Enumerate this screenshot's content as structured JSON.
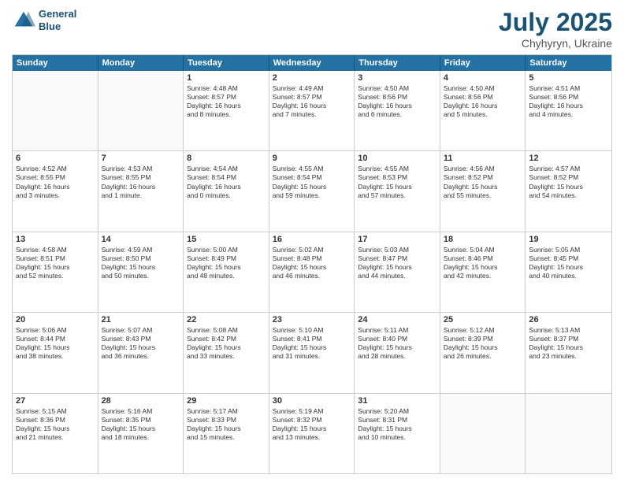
{
  "header": {
    "logo_line1": "General",
    "logo_line2": "Blue",
    "month": "July 2025",
    "location": "Chyhyryn, Ukraine"
  },
  "weekdays": [
    "Sunday",
    "Monday",
    "Tuesday",
    "Wednesday",
    "Thursday",
    "Friday",
    "Saturday"
  ],
  "rows": [
    [
      {
        "day": "",
        "text": "",
        "empty": true
      },
      {
        "day": "",
        "text": "",
        "empty": true
      },
      {
        "day": "1",
        "text": "Sunrise: 4:48 AM\nSunset: 8:57 PM\nDaylight: 16 hours\nand 8 minutes."
      },
      {
        "day": "2",
        "text": "Sunrise: 4:49 AM\nSunset: 8:57 PM\nDaylight: 16 hours\nand 7 minutes."
      },
      {
        "day": "3",
        "text": "Sunrise: 4:50 AM\nSunset: 8:56 PM\nDaylight: 16 hours\nand 6 minutes."
      },
      {
        "day": "4",
        "text": "Sunrise: 4:50 AM\nSunset: 8:56 PM\nDaylight: 16 hours\nand 5 minutes."
      },
      {
        "day": "5",
        "text": "Sunrise: 4:51 AM\nSunset: 8:56 PM\nDaylight: 16 hours\nand 4 minutes."
      }
    ],
    [
      {
        "day": "6",
        "text": "Sunrise: 4:52 AM\nSunset: 8:55 PM\nDaylight: 16 hours\nand 3 minutes."
      },
      {
        "day": "7",
        "text": "Sunrise: 4:53 AM\nSunset: 8:55 PM\nDaylight: 16 hours\nand 1 minute."
      },
      {
        "day": "8",
        "text": "Sunrise: 4:54 AM\nSunset: 8:54 PM\nDaylight: 16 hours\nand 0 minutes."
      },
      {
        "day": "9",
        "text": "Sunrise: 4:55 AM\nSunset: 8:54 PM\nDaylight: 15 hours\nand 59 minutes."
      },
      {
        "day": "10",
        "text": "Sunrise: 4:55 AM\nSunset: 8:53 PM\nDaylight: 15 hours\nand 57 minutes."
      },
      {
        "day": "11",
        "text": "Sunrise: 4:56 AM\nSunset: 8:52 PM\nDaylight: 15 hours\nand 55 minutes."
      },
      {
        "day": "12",
        "text": "Sunrise: 4:57 AM\nSunset: 8:52 PM\nDaylight: 15 hours\nand 54 minutes."
      }
    ],
    [
      {
        "day": "13",
        "text": "Sunrise: 4:58 AM\nSunset: 8:51 PM\nDaylight: 15 hours\nand 52 minutes."
      },
      {
        "day": "14",
        "text": "Sunrise: 4:59 AM\nSunset: 8:50 PM\nDaylight: 15 hours\nand 50 minutes."
      },
      {
        "day": "15",
        "text": "Sunrise: 5:00 AM\nSunset: 8:49 PM\nDaylight: 15 hours\nand 48 minutes."
      },
      {
        "day": "16",
        "text": "Sunrise: 5:02 AM\nSunset: 8:48 PM\nDaylight: 15 hours\nand 46 minutes."
      },
      {
        "day": "17",
        "text": "Sunrise: 5:03 AM\nSunset: 8:47 PM\nDaylight: 15 hours\nand 44 minutes."
      },
      {
        "day": "18",
        "text": "Sunrise: 5:04 AM\nSunset: 8:46 PM\nDaylight: 15 hours\nand 42 minutes."
      },
      {
        "day": "19",
        "text": "Sunrise: 5:05 AM\nSunset: 8:45 PM\nDaylight: 15 hours\nand 40 minutes."
      }
    ],
    [
      {
        "day": "20",
        "text": "Sunrise: 5:06 AM\nSunset: 8:44 PM\nDaylight: 15 hours\nand 38 minutes."
      },
      {
        "day": "21",
        "text": "Sunrise: 5:07 AM\nSunset: 8:43 PM\nDaylight: 15 hours\nand 36 minutes."
      },
      {
        "day": "22",
        "text": "Sunrise: 5:08 AM\nSunset: 8:42 PM\nDaylight: 15 hours\nand 33 minutes."
      },
      {
        "day": "23",
        "text": "Sunrise: 5:10 AM\nSunset: 8:41 PM\nDaylight: 15 hours\nand 31 minutes."
      },
      {
        "day": "24",
        "text": "Sunrise: 5:11 AM\nSunset: 8:40 PM\nDaylight: 15 hours\nand 28 minutes."
      },
      {
        "day": "25",
        "text": "Sunrise: 5:12 AM\nSunset: 8:39 PM\nDaylight: 15 hours\nand 26 minutes."
      },
      {
        "day": "26",
        "text": "Sunrise: 5:13 AM\nSunset: 8:37 PM\nDaylight: 15 hours\nand 23 minutes."
      }
    ],
    [
      {
        "day": "27",
        "text": "Sunrise: 5:15 AM\nSunset: 8:36 PM\nDaylight: 15 hours\nand 21 minutes."
      },
      {
        "day": "28",
        "text": "Sunrise: 5:16 AM\nSunset: 8:35 PM\nDaylight: 15 hours\nand 18 minutes."
      },
      {
        "day": "29",
        "text": "Sunrise: 5:17 AM\nSunset: 8:33 PM\nDaylight: 15 hours\nand 15 minutes."
      },
      {
        "day": "30",
        "text": "Sunrise: 5:19 AM\nSunset: 8:32 PM\nDaylight: 15 hours\nand 13 minutes."
      },
      {
        "day": "31",
        "text": "Sunrise: 5:20 AM\nSunset: 8:31 PM\nDaylight: 15 hours\nand 10 minutes."
      },
      {
        "day": "",
        "text": "",
        "empty": true
      },
      {
        "day": "",
        "text": "",
        "empty": true
      }
    ]
  ]
}
